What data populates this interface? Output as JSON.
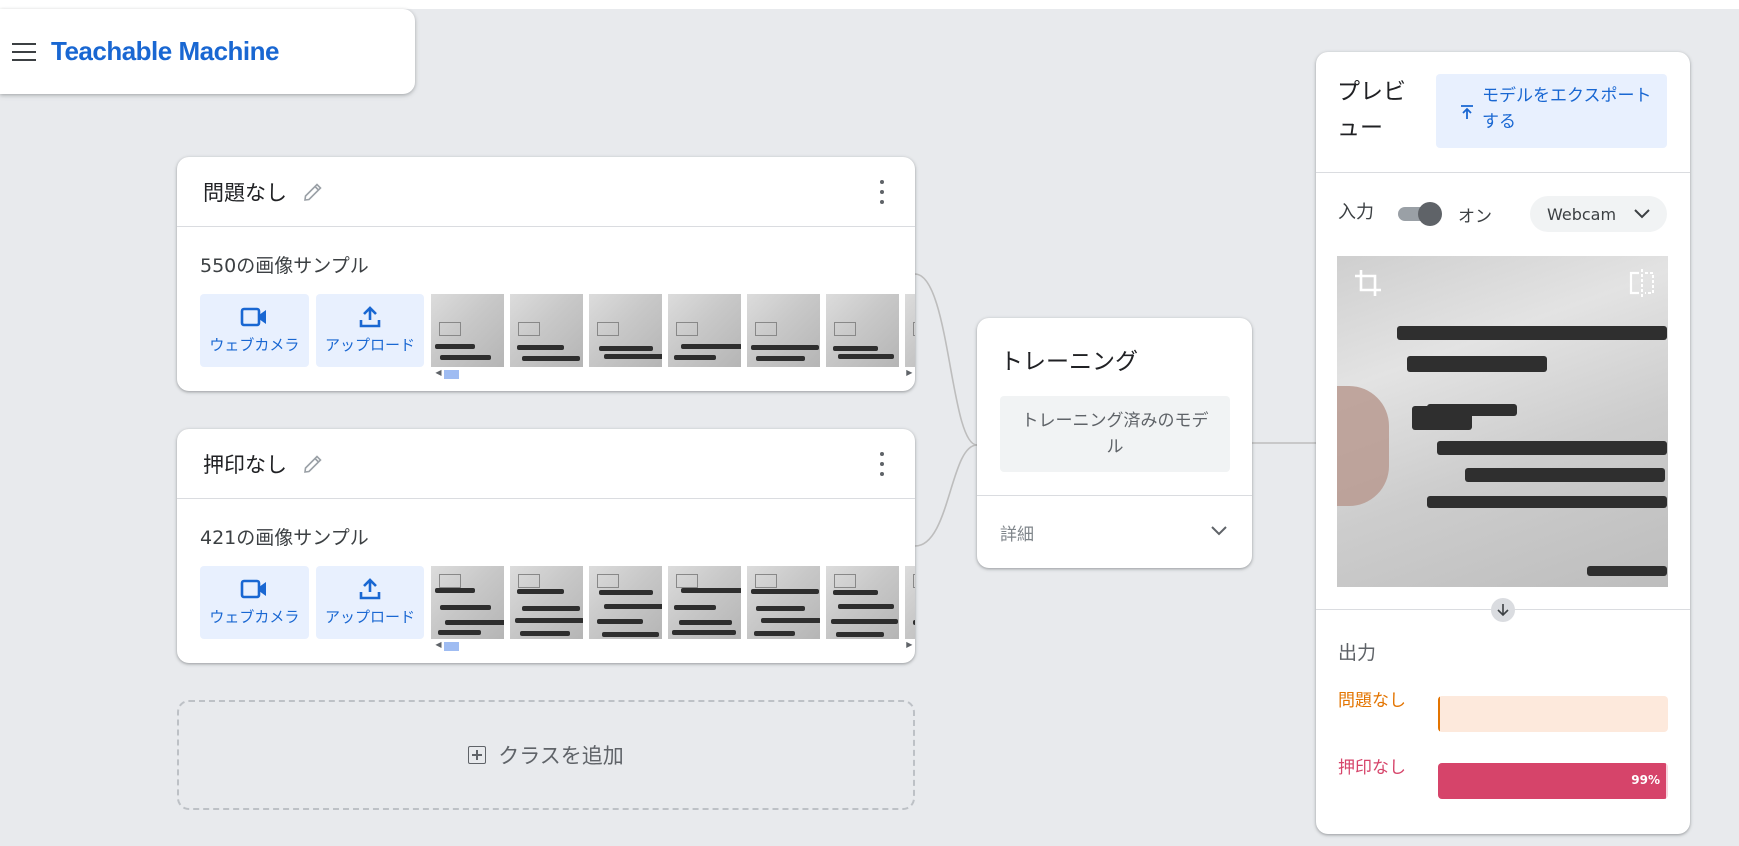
{
  "header": {
    "brand": "Teachable Machine"
  },
  "classes": [
    {
      "name": "問題なし",
      "sample_count": "550の画像サンプル",
      "webcam_label": "ウェブカメラ",
      "upload_label": "アップロード"
    },
    {
      "name": "押印なし",
      "sample_count": "421の画像サンプル",
      "webcam_label": "ウェブカメラ",
      "upload_label": "アップロード"
    }
  ],
  "add_class": {
    "label": "クラスを追加"
  },
  "training": {
    "title": "トレーニング",
    "button": "トレーニング済みのモデル",
    "advanced": "詳細"
  },
  "preview": {
    "title": "プレビュー",
    "export_button": "モデルをエクスポートする",
    "input_label": "入力",
    "toggle_state": "オン",
    "input_source": "Webcam",
    "output_title": "出力",
    "outputs": [
      {
        "label": "問題なし",
        "confidence": 0.01,
        "pct_text": "",
        "color": "#e37400",
        "bg": "#fde9dc"
      },
      {
        "label": "押印なし",
        "confidence": 0.99,
        "pct_text": "99%",
        "color": "#d6446a",
        "bg": "#f7d6df"
      }
    ]
  },
  "colors": {
    "accent": "#1967d2",
    "background": "#e8eaed"
  }
}
